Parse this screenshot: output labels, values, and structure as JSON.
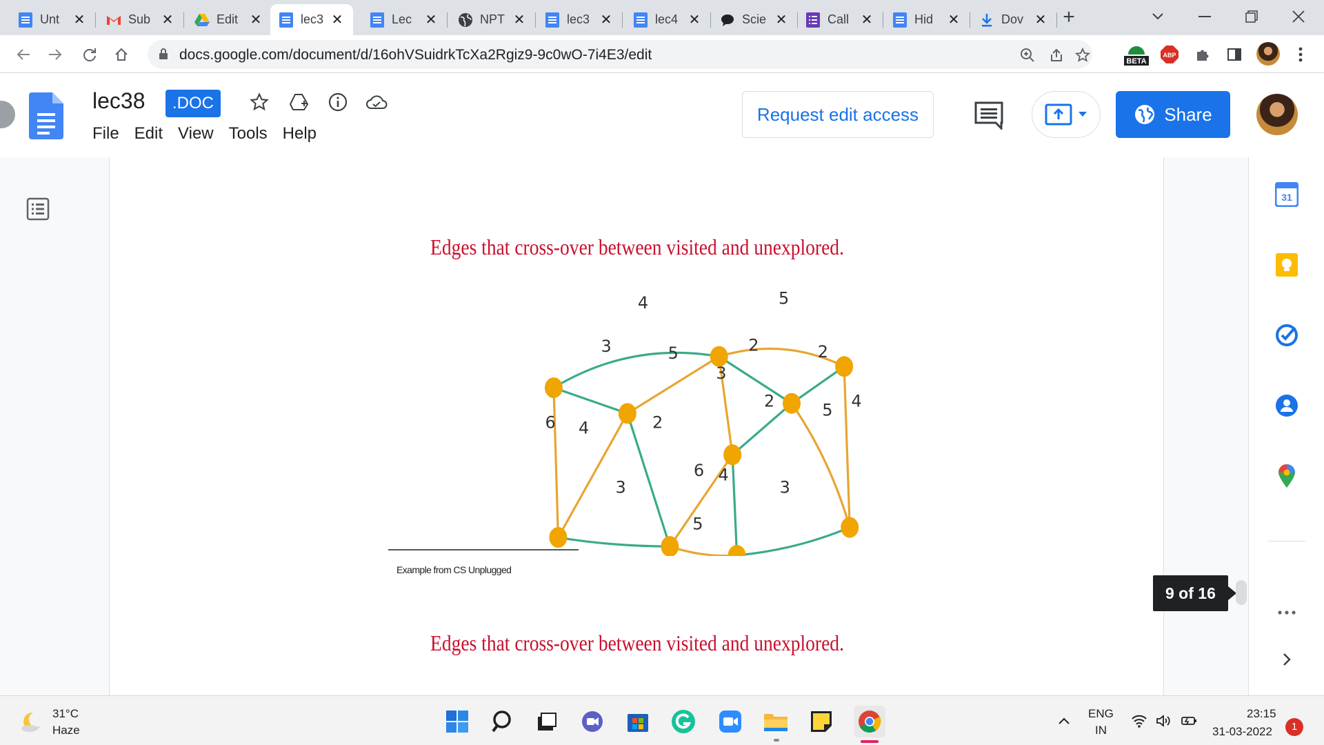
{
  "browser": {
    "tabs": [
      {
        "label": "Unt",
        "icon": "google-docs-icon"
      },
      {
        "label": "Sub",
        "icon": "gmail-icon"
      },
      {
        "label": "Edit",
        "icon": "google-drive-icon"
      },
      {
        "label": "lec3",
        "icon": "google-docs-icon",
        "active": true
      },
      {
        "label": "Lec",
        "icon": "google-docs-icon"
      },
      {
        "label": "NPT",
        "icon": "globe-icon"
      },
      {
        "label": "lec3",
        "icon": "google-docs-icon"
      },
      {
        "label": "lec4",
        "icon": "google-docs-icon"
      },
      {
        "label": "Scie",
        "icon": "chat-bubble-icon"
      },
      {
        "label": "Call",
        "icon": "forms-icon"
      },
      {
        "label": "Hid",
        "icon": "google-docs-icon"
      },
      {
        "label": "Dov",
        "icon": "download-icon"
      }
    ],
    "url": "docs.google.com/document/d/16ohVSuidrkTcXa2Rgiz9-9c0wO-7i4E3/edit",
    "extension_badges": {
      "beta": "BETA",
      "abp": "ABP"
    }
  },
  "doc": {
    "title": "lec38",
    "badge": ".DOC",
    "menu": [
      "File",
      "Edit",
      "View",
      "Tools",
      "Help"
    ],
    "request_access": "Request edit access",
    "share": "Share"
  },
  "content": {
    "slide_title_1": "Edges that cross-over between visited and unexplored.",
    "slide_title_2": "Edges that cross-over between visited and unexplored.",
    "footnote": "Example from CS Unplugged",
    "page_indicator": "9 of 16"
  },
  "graph": {
    "node_color": "#f0a500",
    "visited_edge_color": "#e8a530",
    "unexplored_edge_color": "#3aaa8a",
    "edges": [
      {
        "from": "A",
        "to": "C",
        "weight": "4",
        "kind": "unexplored"
      },
      {
        "from": "C",
        "to": "D",
        "weight": "5",
        "kind": "visited"
      },
      {
        "from": "A",
        "to": "B",
        "weight": "3",
        "kind": "unexplored"
      },
      {
        "from": "B",
        "to": "C",
        "weight": "5",
        "kind": "visited"
      },
      {
        "from": "C",
        "to": "E",
        "weight": "2",
        "kind": "unexplored"
      },
      {
        "from": "D",
        "to": "E",
        "weight": "2",
        "kind": "unexplored"
      },
      {
        "from": "C",
        "to": "F",
        "weight": "3",
        "kind": "visited"
      },
      {
        "from": "A",
        "to": "G",
        "weight": "6",
        "kind": "visited"
      },
      {
        "from": "B",
        "to": "G",
        "weight": "4",
        "kind": "visited"
      },
      {
        "from": "B",
        "to": "H",
        "weight": "2",
        "kind": "unexplored"
      },
      {
        "from": "F",
        "to": "E",
        "weight": "2",
        "kind": "unexplored"
      },
      {
        "from": "E",
        "to": "J",
        "weight": "5",
        "kind": "visited"
      },
      {
        "from": "D",
        "to": "J",
        "weight": "4",
        "kind": "visited"
      },
      {
        "from": "G",
        "to": "H",
        "weight": "3",
        "kind": "unexplored"
      },
      {
        "from": "H",
        "to": "F",
        "weight": "6",
        "kind": "visited"
      },
      {
        "from": "F",
        "to": "I",
        "weight": "4",
        "kind": "unexplored"
      },
      {
        "from": "H",
        "to": "I",
        "weight": "5",
        "kind": "visited"
      },
      {
        "from": "I",
        "to": "J",
        "weight": "3",
        "kind": "unexplored"
      }
    ]
  },
  "sidebar": {
    "icons": [
      "calendar-icon",
      "keep-icon",
      "tasks-icon",
      "contacts-icon",
      "maps-icon",
      "more-icon",
      "expand-icon"
    ],
    "calendar_day": "31"
  },
  "taskbar": {
    "temperature": "31°C",
    "condition": "Haze",
    "lang_1": "ENG",
    "lang_2": "IN",
    "time": "23:15",
    "date": "31-03-2022",
    "notifications": "1"
  }
}
